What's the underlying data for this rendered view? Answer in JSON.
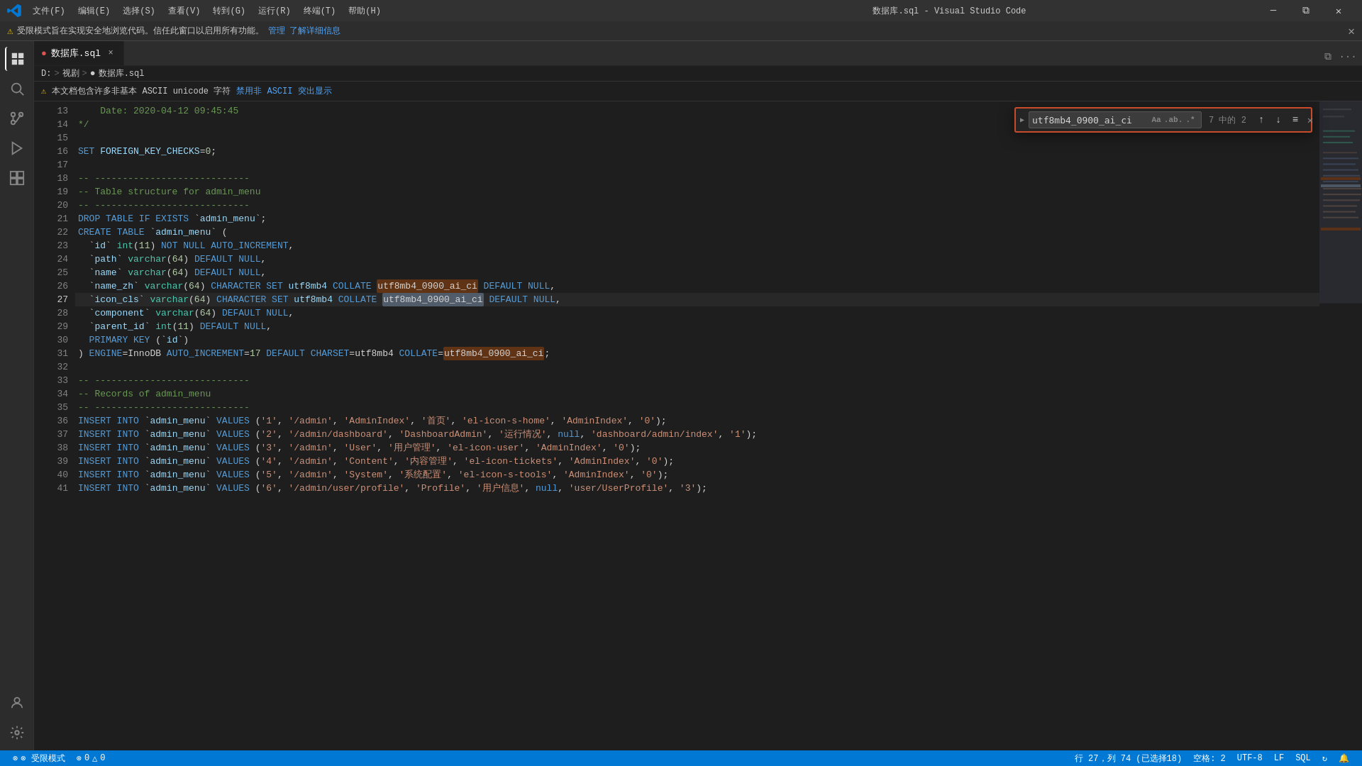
{
  "titlebar": {
    "menu_items": [
      "文件(F)",
      "编辑(E)",
      "选择(S)",
      "查看(V)",
      "转到(G)",
      "运行(R)",
      "终端(T)",
      "帮助(H)"
    ],
    "title": "数据库.sql - Visual Studio Code",
    "controls": [
      "─",
      "□",
      "×"
    ]
  },
  "restricted_bar": {
    "text": "受限模式旨在实现安全地浏览代码。信任此窗口以启用所有功能。",
    "manage": "管理",
    "learn_more": "了解详细信息"
  },
  "breadcrumb": {
    "drive": "D:",
    "sep1": ">",
    "folder": "视剧",
    "sep2": ">",
    "file": "数据库.sql"
  },
  "tab": {
    "name": "数据库.sql",
    "close": "×"
  },
  "warning": {
    "text": "本文档包含许多非基本 ASCII unicode 字符",
    "action": "禁用非 ASCII 突出显示"
  },
  "find_widget": {
    "search_term": "utf8mb4_0900_ai_ci",
    "count": "7 中的 2",
    "match_case_label": "Aa",
    "match_word_label": ".ab.",
    "regex_label": ".*"
  },
  "code_lines": [
    {
      "num": 13,
      "content": "Date: 2020-04-12 09:45:45",
      "type": "comment"
    },
    {
      "num": 14,
      "content": "*/",
      "type": "comment"
    },
    {
      "num": 15,
      "content": "",
      "type": "empty"
    },
    {
      "num": 16,
      "content": "SET FOREIGN_KEY_CHECKS=0;",
      "type": "code"
    },
    {
      "num": 17,
      "content": "",
      "type": "empty"
    },
    {
      "num": 18,
      "content": "-- ----------------------------",
      "type": "comment"
    },
    {
      "num": 19,
      "content": "-- Table structure for admin_menu",
      "type": "comment"
    },
    {
      "num": 20,
      "content": "-- ----------------------------",
      "type": "comment"
    },
    {
      "num": 21,
      "content": "DROP TABLE IF EXISTS `admin_menu`;",
      "type": "code"
    },
    {
      "num": 22,
      "content": "CREATE TABLE `admin_menu` (",
      "type": "code"
    },
    {
      "num": 23,
      "content": "  `id` int(11) NOT NULL AUTO_INCREMENT,",
      "type": "code"
    },
    {
      "num": 24,
      "content": "  `path` varchar(64) DEFAULT NULL,",
      "type": "code"
    },
    {
      "num": 25,
      "content": "  `name` varchar(64) DEFAULT NULL,",
      "type": "code"
    },
    {
      "num": 26,
      "content": "  `name_zh` varchar(64) CHARACTER SET utf8mb4 COLLATE utf8mb4_0900_ai_ci DEFAULT NULL,",
      "type": "code"
    },
    {
      "num": 27,
      "content": "  `icon_cls` varchar(64) CHARACTER SET utf8mb4 COLLATE utf8mb4_0900_ai_ci DEFAULT NULL,",
      "type": "code",
      "current": true
    },
    {
      "num": 28,
      "content": "  `component` varchar(64) DEFAULT NULL,",
      "type": "code"
    },
    {
      "num": 29,
      "content": "  `parent_id` int(11) DEFAULT NULL,",
      "type": "code"
    },
    {
      "num": 30,
      "content": "  PRIMARY KEY (`id`)",
      "type": "code"
    },
    {
      "num": 31,
      "content": ") ENGINE=InnoDB AUTO_INCREMENT=17 DEFAULT CHARSET=utf8mb4 COLLATE=utf8mb4_0900_ai_ci;",
      "type": "code"
    },
    {
      "num": 32,
      "content": "",
      "type": "empty"
    },
    {
      "num": 33,
      "content": "-- ----------------------------",
      "type": "comment"
    },
    {
      "num": 34,
      "content": "-- Records of admin_menu",
      "type": "comment"
    },
    {
      "num": 35,
      "content": "-- ----------------------------",
      "type": "empty"
    },
    {
      "num": 36,
      "content": "INSERT INTO `admin_menu` VALUES ('1', '/admin', 'AdminIndex', '首页', 'el-icon-s-home', 'AdminIndex', '0');",
      "type": "code"
    },
    {
      "num": 37,
      "content": "INSERT INTO `admin_menu` VALUES ('2', '/admin/dashboard', 'DashboardAdmin', '运行情况', null, 'dashboard/admin/index', '1');",
      "type": "code"
    },
    {
      "num": 38,
      "content": "INSERT INTO `admin_menu` VALUES ('3', '/admin', 'User', '用户管理', 'el-icon-user', 'AdminIndex', '0');",
      "type": "code"
    },
    {
      "num": 39,
      "content": "INSERT INTO `admin_menu` VALUES ('4', '/admin', 'Content', '内容管理', 'el-icon-tickets', 'AdminIndex', '0');",
      "type": "code"
    },
    {
      "num": 40,
      "content": "INSERT INTO `admin_menu` VALUES ('5', '/admin', 'System', '系统配置', 'el-icon-s-tools', 'AdminIndex', '0');",
      "type": "code"
    },
    {
      "num": 41,
      "content": "INSERT INTO `admin_menu` VALUES ('6', '/admin/user/profile', 'Profile', '用户信息', null, 'user/UserProfile', '3');",
      "type": "code"
    }
  ],
  "status_bar": {
    "restricted_mode": "⊗ 受限模式",
    "errors": "⊗ 0",
    "warnings": "△ 0",
    "position": "行 27，列 74 (已选择18)",
    "spaces": "空格: 2",
    "encoding": "UTF-8",
    "line_ending": "LF",
    "language": "SQL",
    "sync_icon": "↻",
    "bell_icon": "🔔"
  }
}
